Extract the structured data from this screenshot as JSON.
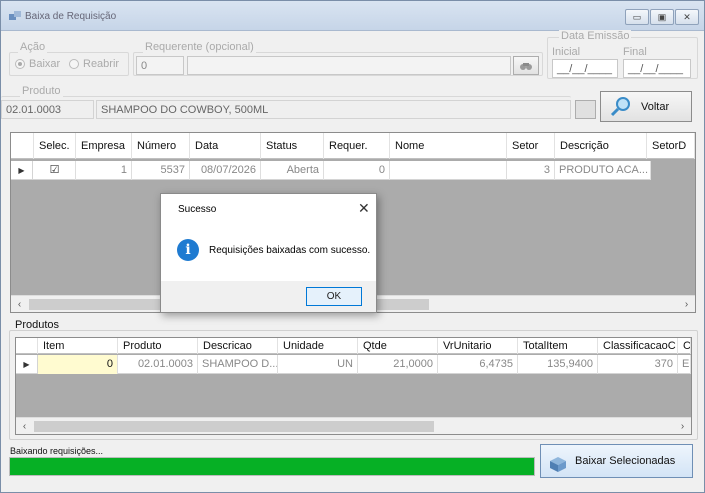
{
  "window": {
    "title": "Baixa de Requisição",
    "minimize": "▭",
    "maximize": "▣",
    "close": "✕"
  },
  "acao": {
    "label": "Ação",
    "baixar": "Baixar",
    "reabrir": "Reabrir"
  },
  "requerente": {
    "label": "Requerente (opcional)",
    "code": "0",
    "name": ""
  },
  "data_emissao": {
    "label": "Data Emissão",
    "inicial": "Inicial",
    "final": "Final",
    "inicial_value": "__/__/____",
    "final_value": "__/__/____"
  },
  "produto": {
    "label": "Produto",
    "code": "02.01.0003",
    "name": "SHAMPOO DO COWBOY, 500ML"
  },
  "voltar_label": "Voltar",
  "req_grid": {
    "columns": [
      "Selec.",
      "Empresa",
      "Número",
      "Data",
      "Status",
      "Requer.",
      "Nome",
      "Setor",
      "Descrição",
      "SetorD"
    ],
    "row": {
      "selected": "☑",
      "empresa": "1",
      "numero": "5537",
      "data": "08/07/2026",
      "status": "Aberta",
      "requer": "0",
      "nome": "",
      "setor": "3",
      "descricao": "PRODUTO ACA..."
    }
  },
  "produtos": {
    "label": "Produtos",
    "columns": [
      "Item",
      "Produto",
      "Descricao",
      "Unidade",
      "Qtde",
      "VrUnitario",
      "TotalItem",
      "ClassificacaoC",
      "C"
    ],
    "row": {
      "item": "0",
      "produto": "02.01.0003",
      "descricao": "SHAMPOO D...",
      "unidade": "UN",
      "qtde": "21,0000",
      "vrunitario": "6,4735",
      "totalitem": "135,9400",
      "classificacao": "370",
      "c": "E"
    }
  },
  "dialog": {
    "title": "Sucesso",
    "message": "Requisições baixadas com sucesso.",
    "ok": "OK",
    "icon": "information-icon"
  },
  "status_text": "Baixando requisições...",
  "progress": {
    "percent": 100,
    "color": "#06b025"
  },
  "baixar_selecionadas_label": "Baixar Selecionadas"
}
